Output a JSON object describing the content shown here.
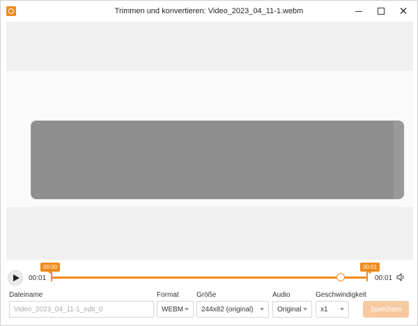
{
  "window": {
    "title": "Trimmen und konvertieren: Video_2023_04_11-1.webm",
    "min_icon": "minimize-icon",
    "max_icon": "maximize-icon",
    "close_icon": "close-icon"
  },
  "timeline": {
    "current_time": "00:01",
    "end_time": "00:01",
    "marker_start": "00:00",
    "marker_end": "00:01",
    "accent_color": "#f08a1c"
  },
  "form": {
    "filename_label": "Dateiname",
    "filename_placeholder": "Video_2023_04_11-1_edit_0",
    "format_label": "Format",
    "format_value": "WEBM",
    "size_label": "Größe",
    "size_value": "244x82 (original)",
    "audio_label": "Audio",
    "audio_value": "Original",
    "speed_label": "Geschwindigkeit",
    "speed_value": "x1",
    "save_label": "Speichern"
  }
}
